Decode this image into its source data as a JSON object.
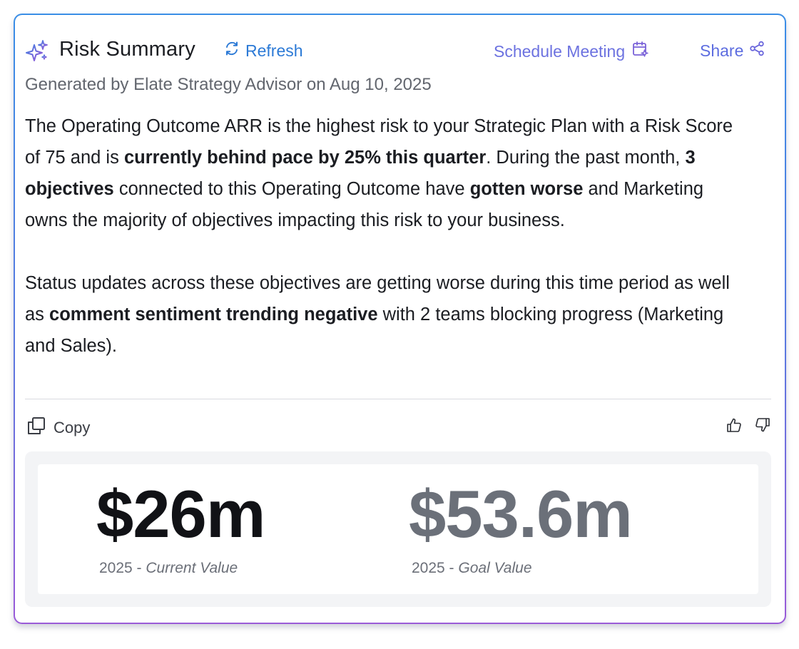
{
  "header": {
    "title": "Risk Summary",
    "refresh_label": "Refresh",
    "schedule_label": "Schedule Meeting",
    "share_label": "Share"
  },
  "subtitle": "Generated by Elate Strategy Advisor on Aug 10, 2025",
  "summary": {
    "p1": {
      "t1": "The Operating Outcome ARR is the highest risk to your Strategic Plan with a Risk Score of 75 and is ",
      "b1": "currently behind pace by 25% this quarter",
      "t2": ". During the past month, ",
      "b2": "3 objectives",
      "t3": " connected to this Operating Outcome have ",
      "b3": "gotten worse",
      "t4": " and Marketing owns the majority of objectives impacting this risk to your business."
    },
    "p2": {
      "t1": "Status updates across these objectives are getting worse during this time period as well as ",
      "b1": "comment sentiment trending negative",
      "t2": " with 2 teams blocking progress (Marketing and Sales)."
    }
  },
  "actions": {
    "copy_label": "Copy",
    "thumbs_up_icon": "thumbs-up-icon",
    "thumbs_down_icon": "thumbs-down-icon"
  },
  "metrics": {
    "current": {
      "value": "$26m",
      "year": "2025 - ",
      "label": "Current Value"
    },
    "goal": {
      "value": "$53.6m",
      "year": "2025 - ",
      "label": "Goal Value"
    }
  },
  "colors": {
    "accent_blue": "#2c7ad6",
    "accent_purple": "#6c72e0",
    "border_gradient_start": "#3a8ee6",
    "border_gradient_end": "#9a5ad8"
  }
}
